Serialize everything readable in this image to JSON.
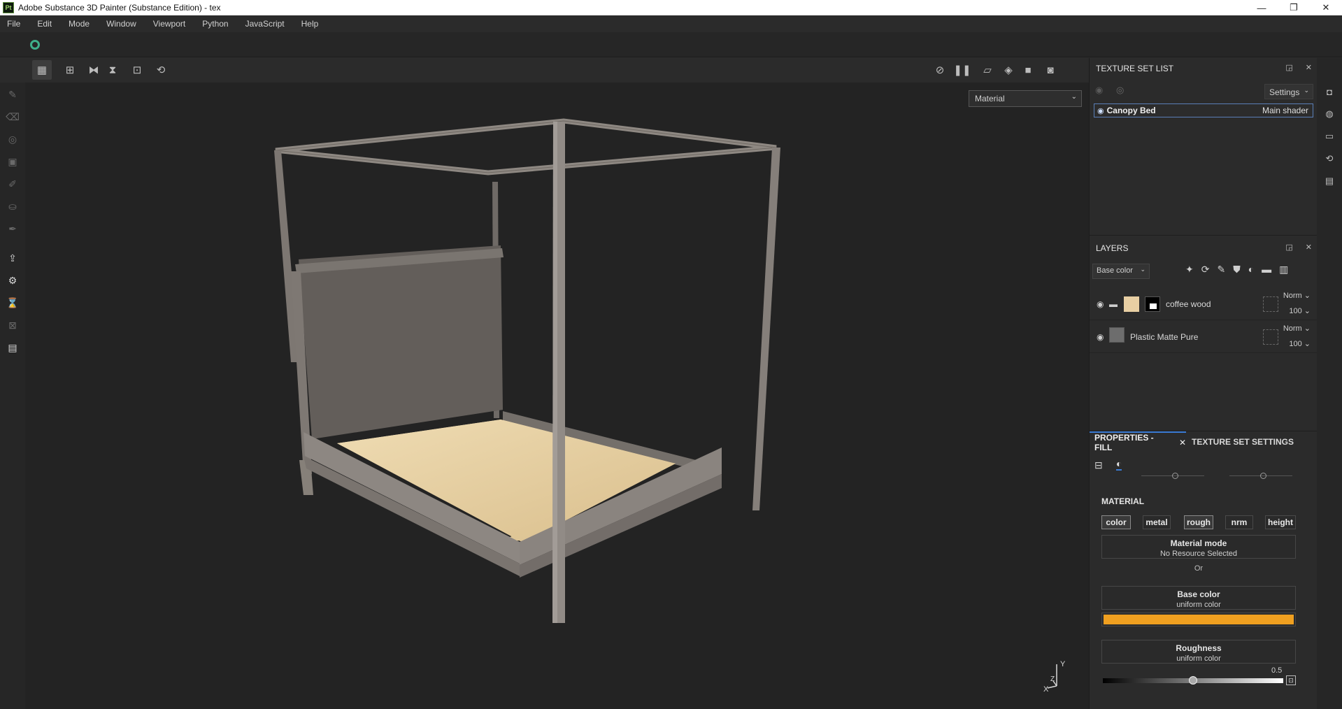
{
  "window": {
    "title": "Adobe Substance 3D Painter (Substance Edition) - tex",
    "app_icon": "Pt",
    "minimize": "—",
    "maximize": "❐",
    "close": "✕"
  },
  "menu": {
    "items": [
      "File",
      "Edit",
      "Mode",
      "Window",
      "Viewport",
      "Python",
      "JavaScript",
      "Help"
    ]
  },
  "viewport": {
    "material_dropdown": "Material",
    "axis_y": "Y",
    "axis_z": "Z",
    "axis_x": "X"
  },
  "texture_set_list": {
    "title": "TEXTURE SET LIST",
    "settings_label": "Settings",
    "row_name": "Canopy Bed",
    "row_shader": "Main shader"
  },
  "layers": {
    "title": "LAYERS",
    "channel_dropdown": "Base color",
    "rows": [
      {
        "name": "coffee wood",
        "blend": "Norm",
        "opacity": "100"
      },
      {
        "name": "Plastic Matte Pure",
        "blend": "Norm",
        "opacity": "100"
      }
    ]
  },
  "properties": {
    "tab_fill": "PROPERTIES - FILL",
    "tab_texture_set": "TEXTURE SET SETTINGS",
    "section_material": "MATERIAL",
    "material_buttons": [
      "color",
      "metal",
      "rough",
      "nrm",
      "height"
    ],
    "material_mode_title": "Material mode",
    "material_mode_value": "No Resource Selected",
    "or_label": "Or",
    "base_color_title": "Base color",
    "base_color_sub": "uniform color",
    "base_color_hex": "#f0a020",
    "roughness_title": "Roughness",
    "roughness_sub": "uniform color",
    "roughness_value": "0.5",
    "roughness_fraction": 0.5
  },
  "colors": {
    "accent": "#3a7bd5",
    "wood": "#e8cfa3",
    "base_color": "#f0a020"
  }
}
